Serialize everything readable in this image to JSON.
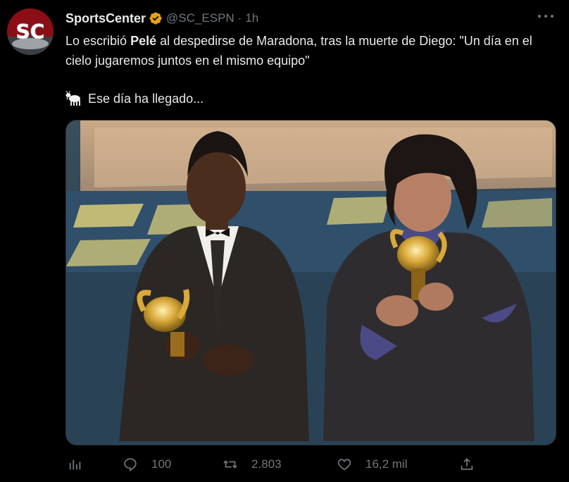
{
  "tweet": {
    "author_name": "SportsCenter",
    "handle": "@SC_ESPN",
    "separator": "·",
    "time": "1h",
    "text_part1": "Lo escribió ",
    "text_bold": "Pelé",
    "text_part2": " al despedirse de Maradona, tras la muerte de Diego: \"Un día en el cielo jugaremos juntos en el mismo equipo\"",
    "text_line2": "Ese día ha llegado...",
    "avatar_logo": "SC"
  },
  "actions": {
    "replies": "100",
    "retweets": "2.803",
    "likes": "16,2 mil"
  },
  "icons": {
    "verified": "verified-badge-icon",
    "more": "more-icon",
    "goat": "goat-emoji-icon",
    "analytics": "analytics-icon",
    "reply": "reply-icon",
    "retweet": "retweet-icon",
    "like": "heart-icon",
    "share": "share-icon"
  },
  "colors": {
    "background": "#000000",
    "text": "#e7e9ea",
    "muted": "#71767b",
    "verified": "#e8a21a"
  }
}
